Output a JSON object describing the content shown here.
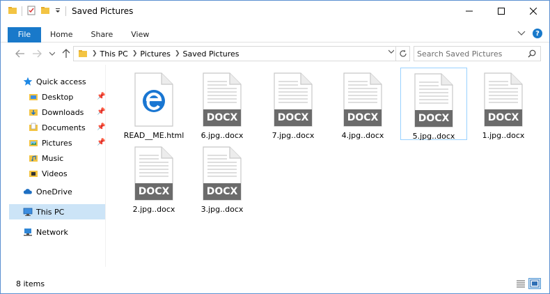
{
  "window": {
    "title": "Saved Pictures",
    "accent": "#1979ca"
  },
  "ribbon": {
    "file_tab": "File",
    "tabs": [
      "Home",
      "Share",
      "View"
    ]
  },
  "address": {
    "crumbs": [
      "This PC",
      "Pictures",
      "Saved Pictures"
    ]
  },
  "search": {
    "placeholder": "Search Saved Pictures"
  },
  "sidebar": {
    "items": [
      {
        "label": "Quick access",
        "icon": "star-icon",
        "pinned": false
      },
      {
        "label": "Desktop",
        "icon": "desktop-folder-icon",
        "pinned": true
      },
      {
        "label": "Downloads",
        "icon": "downloads-folder-icon",
        "pinned": true
      },
      {
        "label": "Documents",
        "icon": "documents-folder-icon",
        "pinned": true
      },
      {
        "label": "Pictures",
        "icon": "pictures-folder-icon",
        "pinned": true
      },
      {
        "label": "Music",
        "icon": "music-folder-icon",
        "pinned": false
      },
      {
        "label": "Videos",
        "icon": "videos-folder-icon",
        "pinned": false
      },
      {
        "label": "OneDrive",
        "icon": "cloud-icon",
        "pinned": false
      },
      {
        "label": "This PC",
        "icon": "computer-icon",
        "pinned": false
      },
      {
        "label": "Network",
        "icon": "network-icon",
        "pinned": false
      }
    ],
    "selected": "This PC"
  },
  "files": [
    {
      "name": "READ__ME.html",
      "type": "edge-html-icon",
      "badge": ""
    },
    {
      "name": "6.jpg..docx",
      "type": "docx-icon",
      "badge": "DOCX"
    },
    {
      "name": "7.jpg..docx",
      "type": "docx-icon",
      "badge": "DOCX"
    },
    {
      "name": "4.jpg..docx",
      "type": "docx-icon",
      "badge": "DOCX"
    },
    {
      "name": "5.jpg..docx",
      "type": "docx-icon",
      "badge": "DOCX",
      "selected": true
    },
    {
      "name": "1.jpg..docx",
      "type": "docx-icon",
      "badge": "DOCX"
    },
    {
      "name": "2.jpg..docx",
      "type": "docx-icon",
      "badge": "DOCX"
    },
    {
      "name": "3.jpg..docx",
      "type": "docx-icon",
      "badge": "DOCX"
    }
  ],
  "status": {
    "count": "8 items"
  }
}
